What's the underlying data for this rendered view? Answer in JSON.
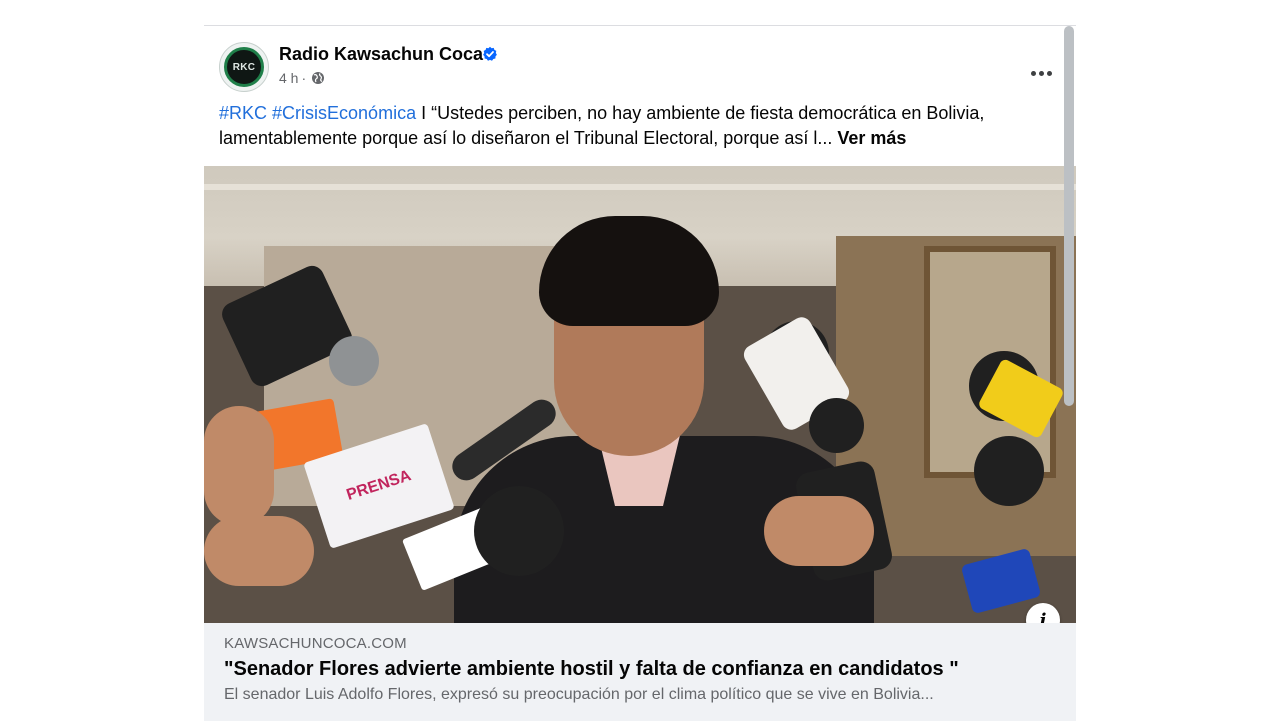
{
  "post": {
    "page_name": "Radio Kawsachun Coca",
    "avatar_text": "RKC",
    "verified_icon": "verified-badge-icon",
    "time": "4 h",
    "separator": "·",
    "privacy_icon": "globe-icon",
    "more_icon": "more-options-icon",
    "caption": {
      "hashtag1": "#RKC",
      "hashtag2": "#CrisisEconómica",
      "text": " I “Ustedes perciben, no hay ambiente de fiesta democrática en Bolivia, lamentablemente porque así lo diseñaron el Tribunal Electoral, porque así l...",
      "see_more": "Ver más"
    },
    "image_mic_label": "PRENSA"
  },
  "link_preview": {
    "domain": "KAWSACHUNCOCA.COM",
    "title": "\"Senador Flores advierte ambiente hostil y falta de confianza en candidatos \"",
    "description": "El senador Luis Adolfo Flores, expresó su preocupación por el clima político que se vive en Bolivia...",
    "info_icon": "info-icon",
    "info_glyph": "i"
  },
  "colors": {
    "hashtag": "#216fdb",
    "secondary_text": "#65676b",
    "preview_bg": "#f0f2f5",
    "verified": "#0866ff"
  }
}
